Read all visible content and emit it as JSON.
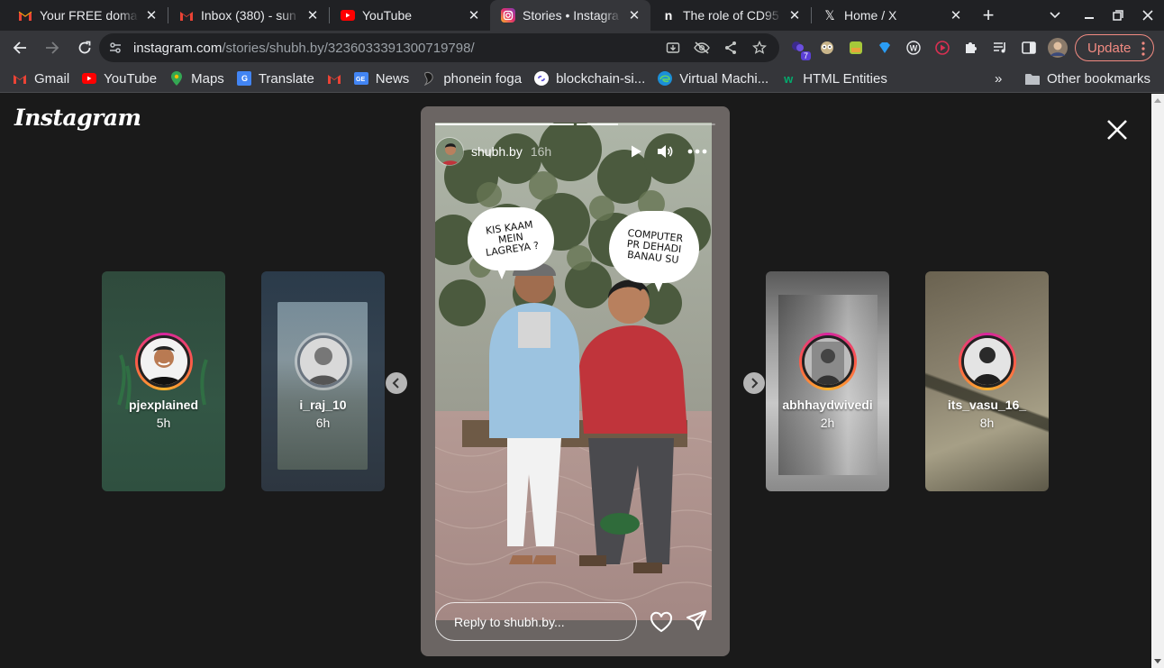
{
  "browser": {
    "tabs": [
      {
        "title": "Your FREE doma",
        "icon": "gmail-icon"
      },
      {
        "title": "Inbox (380) - sun",
        "icon": "gmail-icon"
      },
      {
        "title": "YouTube",
        "icon": "youtube-icon"
      },
      {
        "title": "Stories • Instagra",
        "icon": "instagram-icon",
        "active": true
      },
      {
        "title": "The role of CD95",
        "icon": "notion-icon"
      },
      {
        "title": "Home / X",
        "icon": "x-icon"
      }
    ],
    "url_host": "instagram.com",
    "url_path": "/stories/shubh.by/3236033391300719798/",
    "extension_badge": "7",
    "update_label": "Update"
  },
  "bookmarks": [
    {
      "label": "Gmail",
      "icon": "gmail-icon"
    },
    {
      "label": "YouTube",
      "icon": "youtube-icon"
    },
    {
      "label": "Maps",
      "icon": "maps-icon"
    },
    {
      "label": "Translate",
      "icon": "translate-icon"
    },
    {
      "label": "",
      "icon": "gmail-icon"
    },
    {
      "label": "News",
      "icon": "news-icon"
    },
    {
      "label": "phonein foga",
      "icon": "phonein-icon"
    },
    {
      "label": "blockchain-si...",
      "icon": "blockchain-icon"
    },
    {
      "label": "Virtual Machi...",
      "icon": "edge-icon"
    },
    {
      "label": "HTML Entities",
      "icon": "w3-icon"
    }
  ],
  "bookmarks_more": "»",
  "other_bookmarks": "Other bookmarks",
  "page": {
    "logo": "Instagram",
    "side_stories": [
      {
        "username": "pjexplained",
        "time": "5h"
      },
      {
        "username": "i_raj_10",
        "time": "6h"
      },
      {
        "username": "abhhaydwivedi",
        "time": "2h"
      },
      {
        "username": "its_vasu_16_",
        "time": "8h"
      }
    ],
    "story": {
      "username": "shubh.by",
      "time": "16h",
      "progress": [
        1.0,
        0.3
      ],
      "bubble_left": "KIS KAAM MEIN LAGREYA ?",
      "bubble_right": "COMPUTER PR DEHADI BANAU SU",
      "reply_placeholder": "Reply to shubh.by..."
    }
  }
}
